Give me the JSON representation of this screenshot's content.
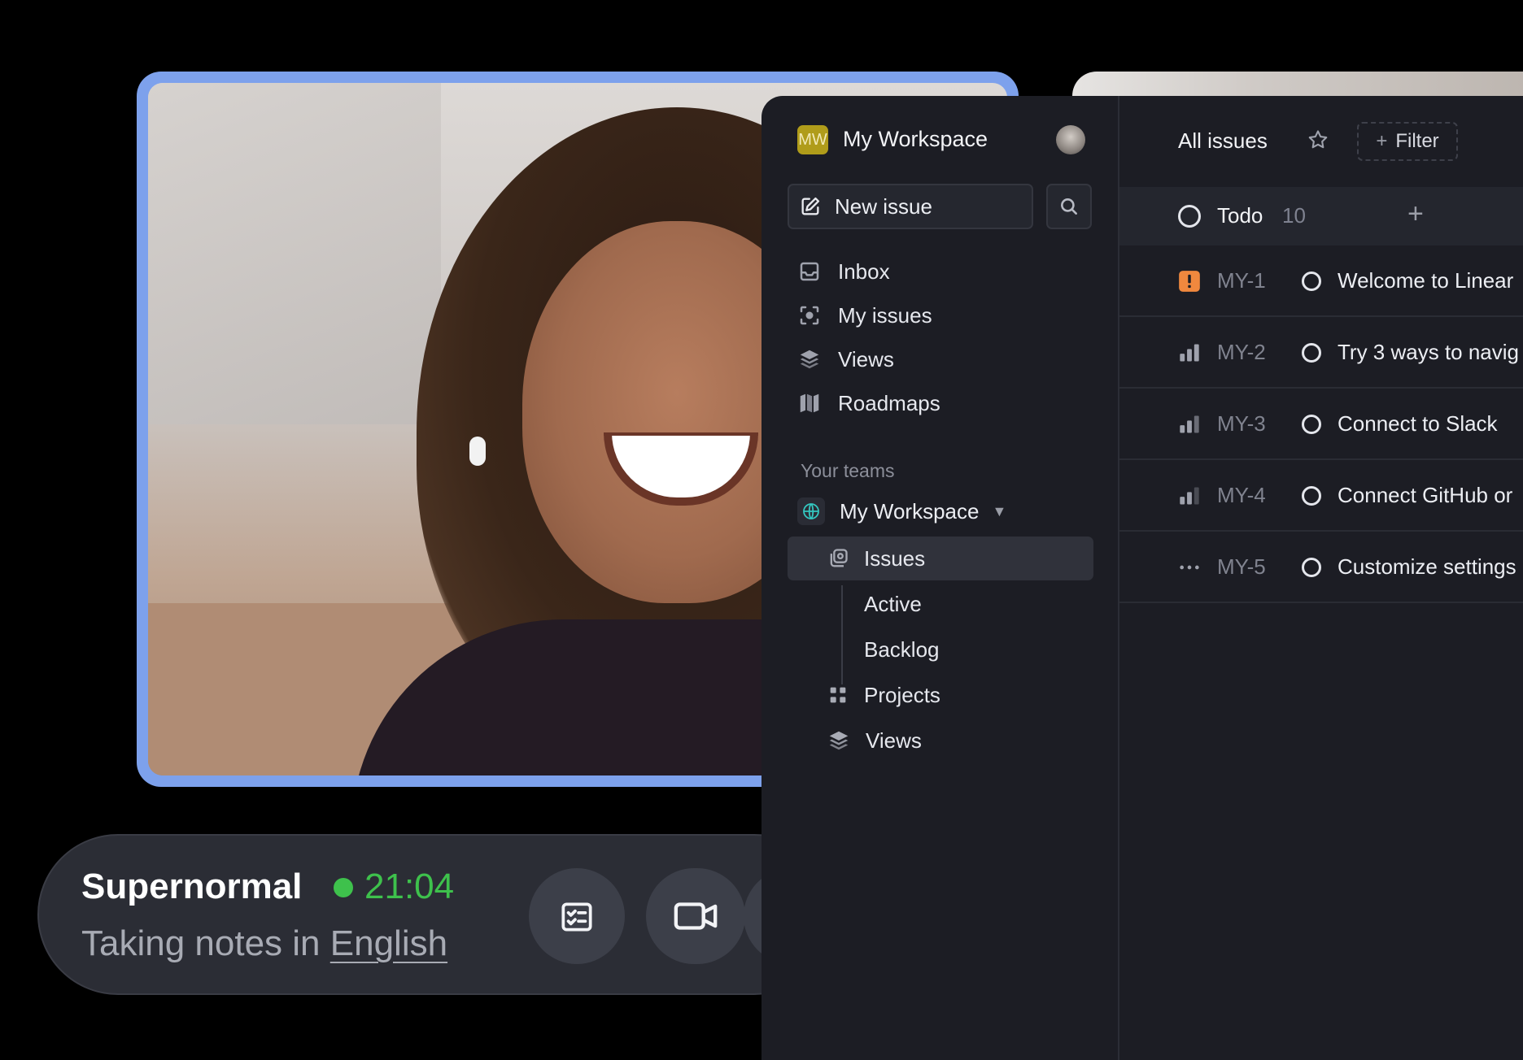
{
  "call": {
    "app_name": "Supernormal",
    "timer": "21:04",
    "subtitle_prefix": "Taking notes in",
    "language": "English",
    "status_color": "#3ec14c"
  },
  "workspace": {
    "badge": "MW",
    "name": "My Workspace"
  },
  "sidebar": {
    "new_issue_label": "New issue",
    "nav": [
      {
        "label": "Inbox",
        "icon": "inbox-icon"
      },
      {
        "label": "My issues",
        "icon": "my-issues-icon"
      },
      {
        "label": "Views",
        "icon": "layers-icon"
      },
      {
        "label": "Roadmaps",
        "icon": "map-icon"
      }
    ],
    "teams_title": "Your teams",
    "team": {
      "name": "My Workspace",
      "items": [
        {
          "label": "Issues"
        },
        {
          "label": "Active"
        },
        {
          "label": "Backlog"
        },
        {
          "label": "Projects"
        },
        {
          "label": "Views"
        }
      ]
    }
  },
  "main": {
    "title": "All issues",
    "filter_label": "Filter",
    "group": {
      "name": "Todo",
      "count": "10"
    },
    "issues": [
      {
        "id": "MY-1",
        "title": "Welcome to Linear",
        "priority": "urgent"
      },
      {
        "id": "MY-2",
        "title": "Try 3 ways to navig",
        "priority": "high"
      },
      {
        "id": "MY-3",
        "title": "Connect to Slack",
        "priority": "high"
      },
      {
        "id": "MY-4",
        "title": "Connect GitHub or",
        "priority": "medium"
      },
      {
        "id": "MY-5",
        "title": "Customize settings",
        "priority": "none"
      }
    ]
  },
  "colors": {
    "accent_frame": "#7da1ec",
    "urgent": "#f0883e",
    "workspace_badge": "#b09c1a"
  }
}
